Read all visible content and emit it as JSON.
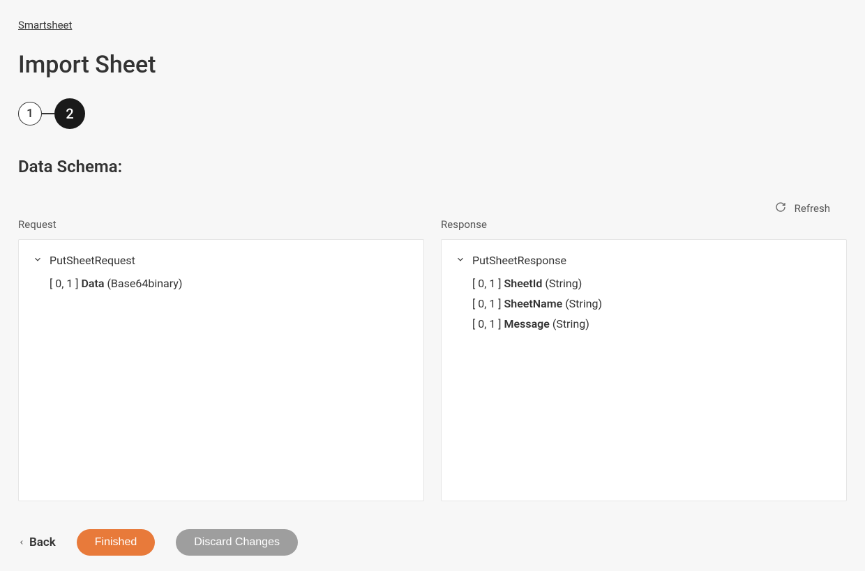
{
  "breadcrumb": {
    "label": "Smartsheet"
  },
  "page_title": "Import Sheet",
  "stepper": {
    "step1": "1",
    "step2": "2"
  },
  "section_title": "Data Schema:",
  "refresh": {
    "label": "Refresh"
  },
  "request": {
    "label": "Request",
    "root": "PutSheetRequest",
    "fields": [
      {
        "cardinality": "[ 0, 1 ]",
        "name": "Data",
        "type": "(Base64binary)"
      }
    ]
  },
  "response": {
    "label": "Response",
    "root": "PutSheetResponse",
    "fields": [
      {
        "cardinality": "[ 0, 1 ]",
        "name": "SheetId",
        "type": "(String)"
      },
      {
        "cardinality": "[ 0, 1 ]",
        "name": "SheetName",
        "type": "(String)"
      },
      {
        "cardinality": "[ 0, 1 ]",
        "name": "Message",
        "type": "(String)"
      }
    ]
  },
  "footer": {
    "back": "Back",
    "finished": "Finished",
    "discard": "Discard Changes"
  }
}
